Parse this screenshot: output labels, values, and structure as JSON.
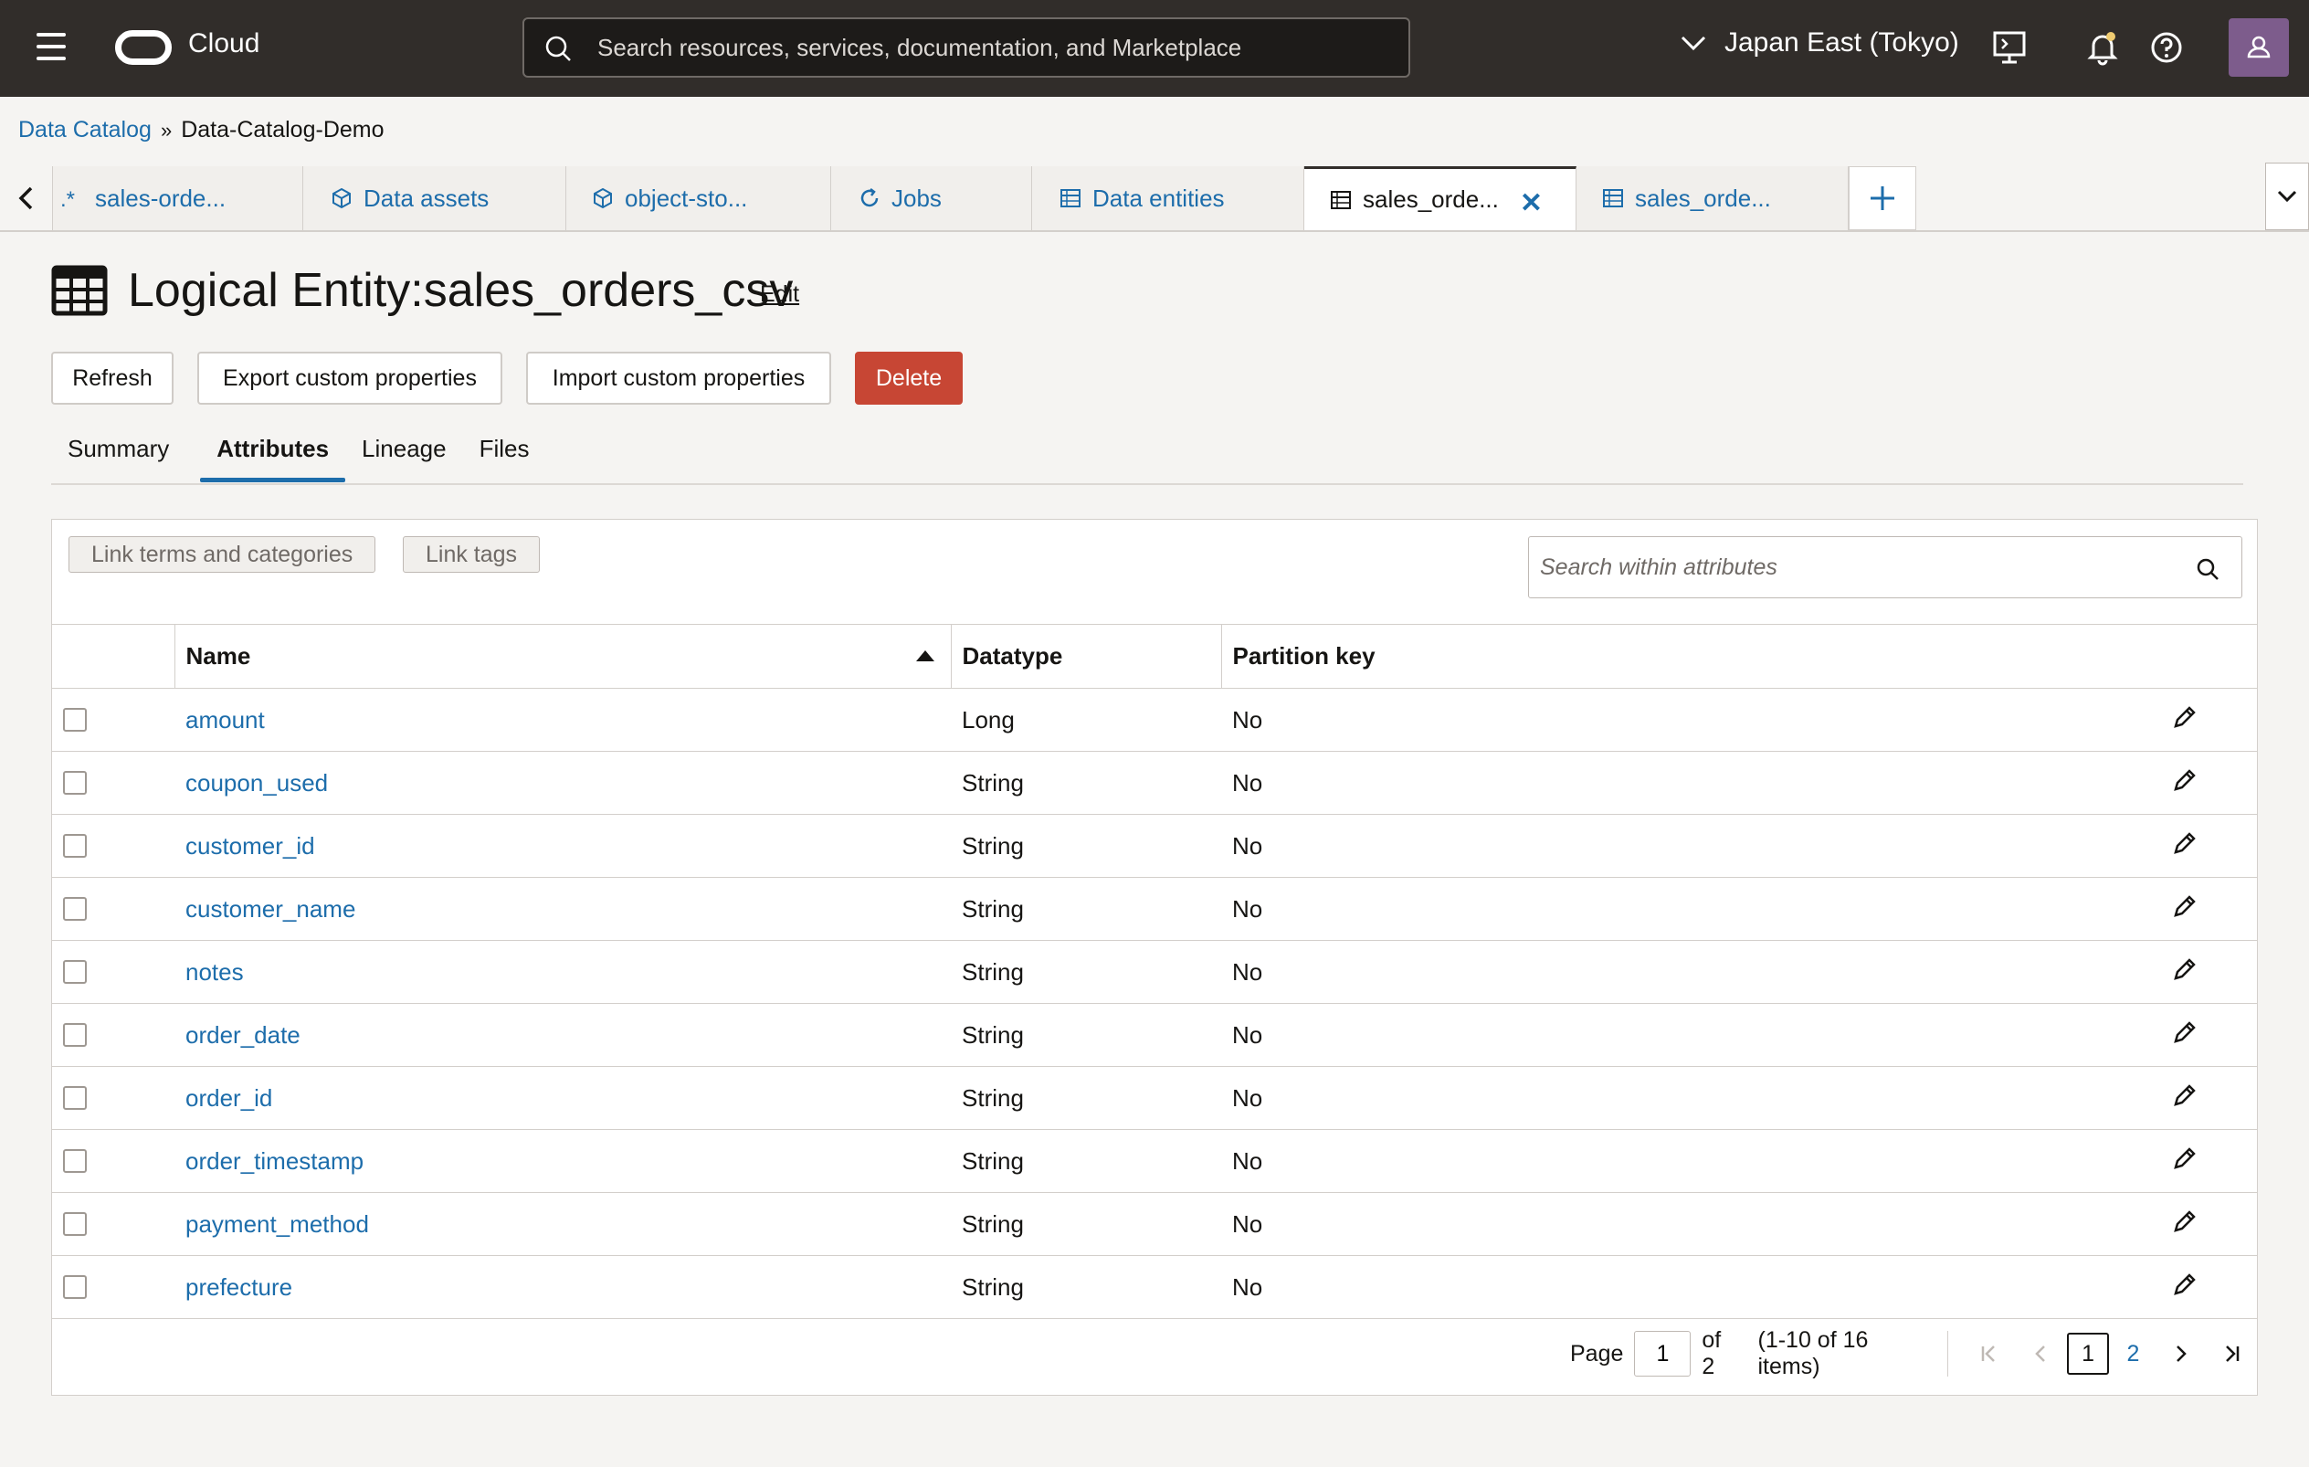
{
  "header": {
    "brand": "Cloud",
    "search_placeholder": "Search resources, services, documentation, and Marketplace",
    "region": "Japan East (Tokyo)"
  },
  "breadcrumb": {
    "root": "Data Catalog",
    "separator": "»",
    "current": "Data-Catalog-Demo"
  },
  "tabs": [
    {
      "label": "sales-orde...",
      "icon": "regex-icon"
    },
    {
      "label": "Data assets",
      "icon": "cube-icon"
    },
    {
      "label": "object-sto...",
      "icon": "cube-icon"
    },
    {
      "label": "Jobs",
      "icon": "refresh-icon"
    },
    {
      "label": "Data entities",
      "icon": "table-icon"
    },
    {
      "label": "sales_orde...",
      "icon": "table-icon",
      "active": true
    },
    {
      "label": "sales_orde...",
      "icon": "table-icon"
    }
  ],
  "page": {
    "title": "Logical Entity:sales_orders_csv",
    "edit_label": "Edit"
  },
  "actions": {
    "refresh": "Refresh",
    "export": "Export custom properties",
    "import": "Import custom properties",
    "delete": "Delete"
  },
  "subtabs": [
    "Summary",
    "Attributes",
    "Lineage",
    "Files"
  ],
  "panel": {
    "link_terms": "Link terms and categories",
    "link_tags": "Link tags",
    "search_placeholder": "Search within attributes"
  },
  "table": {
    "columns": [
      "Name",
      "Datatype",
      "Partition key"
    ],
    "rows": [
      {
        "name": "amount",
        "datatype": "Long",
        "partition": "No"
      },
      {
        "name": "coupon_used",
        "datatype": "String",
        "partition": "No"
      },
      {
        "name": "customer_id",
        "datatype": "String",
        "partition": "No"
      },
      {
        "name": "customer_name",
        "datatype": "String",
        "partition": "No"
      },
      {
        "name": "notes",
        "datatype": "String",
        "partition": "No"
      },
      {
        "name": "order_date",
        "datatype": "String",
        "partition": "No"
      },
      {
        "name": "order_id",
        "datatype": "String",
        "partition": "No"
      },
      {
        "name": "order_timestamp",
        "datatype": "String",
        "partition": "No"
      },
      {
        "name": "payment_method",
        "datatype": "String",
        "partition": "No"
      },
      {
        "name": "prefecture",
        "datatype": "String",
        "partition": "No"
      }
    ]
  },
  "pager": {
    "page_label": "Page",
    "page_value": "1",
    "of_label": "of 2",
    "range": "(1-10 of 16 items)",
    "pages": [
      "1",
      "2"
    ]
  },
  "colors": {
    "topbar": "#312d2a",
    "link": "#1d6dab",
    "danger": "#c74634"
  }
}
